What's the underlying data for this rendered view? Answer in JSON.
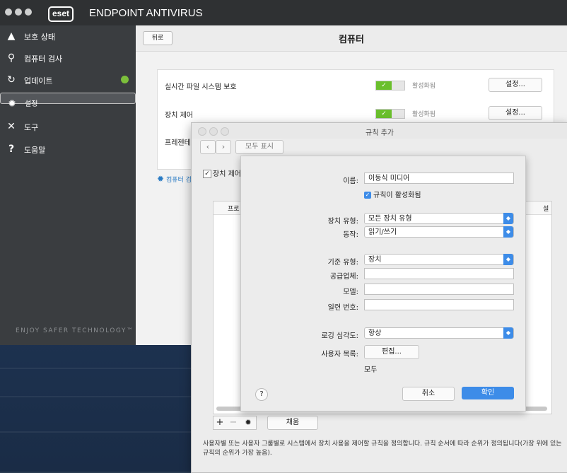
{
  "brand": {
    "logo": "eset",
    "product": "ENDPOINT ANTIVIRUS"
  },
  "sidebar": {
    "items": [
      {
        "label": "보호 상태",
        "icon": "warning-icon"
      },
      {
        "label": "컴퓨터 검사",
        "icon": "search-icon"
      },
      {
        "label": "업데이트",
        "icon": "refresh-icon"
      },
      {
        "label": "설정",
        "icon": "gear-icon"
      },
      {
        "label": "도구",
        "icon": "tools-icon"
      },
      {
        "label": "도움말",
        "icon": "question-icon"
      }
    ],
    "tagline": "ENJOY SAFER TECHNOLOGY™"
  },
  "header": {
    "back": "뒤로",
    "title": "컴퓨터"
  },
  "settings": {
    "rows": [
      {
        "label": "실시간 파일 시스템 보호",
        "status": "활성화됨",
        "button": "설정..."
      },
      {
        "label": "장치 제어",
        "status": "활성화됨",
        "button": "설정..."
      },
      {
        "label": "프레젠테"
      }
    ],
    "link": "컴퓨터 검"
  },
  "rule_dialog": {
    "title": "규칙 추가",
    "show_all": "모두 표시",
    "device_control": "장치 제어",
    "table_header_left": "프로",
    "table_header_right": "설",
    "fill_button": "채움",
    "description": "사용자별 또는 사용자 그룹별로 시스템에서 장치 사용을 제어할 규칙을 정의합니다. 규칙 순서에 따라 순위가 정의됩니다(가장 위에 있는 규칙의 순위가 가장 높음)."
  },
  "sheet": {
    "name_label": "이름:",
    "name_value": "이동식 미디어",
    "enabled_label": "규칙이 활성화됨",
    "device_type_label": "장치 유형:",
    "device_type_value": "모든 장치 유형",
    "action_label": "동작:",
    "action_value": "읽기/쓰기",
    "criteria_label": "기준 유형:",
    "criteria_value": "장치",
    "vendor_label": "공급업체:",
    "model_label": "모델:",
    "serial_label": "일련 번호:",
    "log_label": "로깅 심각도:",
    "log_value": "항상",
    "users_label": "사용자 목록:",
    "edit_button": "편집...",
    "users_value": "모두",
    "help": "?",
    "cancel": "취소",
    "ok": "확인"
  },
  "colors": {
    "accent": "#3d8ce8",
    "enabled": "#6abf2c",
    "sidebar": "#3a3d40"
  }
}
